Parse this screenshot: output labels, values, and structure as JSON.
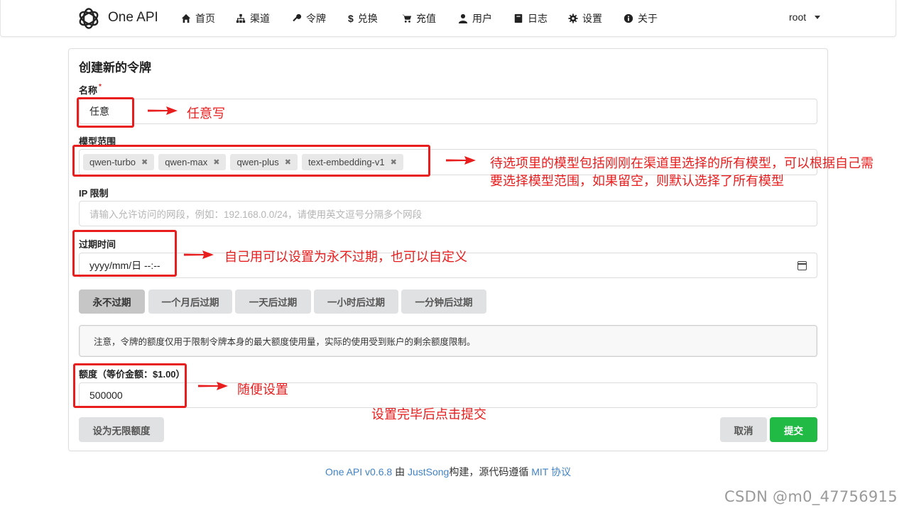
{
  "nav": {
    "brand": "One API",
    "items": [
      {
        "label": "首页",
        "icon": "home-icon"
      },
      {
        "label": "渠道",
        "icon": "sitemap-icon"
      },
      {
        "label": "令牌",
        "icon": "key-icon"
      },
      {
        "label": "兑换",
        "icon": "dollar-icon"
      },
      {
        "label": "充值",
        "icon": "cart-icon"
      },
      {
        "label": "用户",
        "icon": "user-icon"
      },
      {
        "label": "日志",
        "icon": "book-icon"
      },
      {
        "label": "设置",
        "icon": "gear-icon"
      },
      {
        "label": "关于",
        "icon": "info-icon"
      }
    ],
    "user": "root"
  },
  "form": {
    "title": "创建新的令牌",
    "name_label": "名称",
    "name_required_mark": "*",
    "name_value": "任意",
    "models_label": "模型范围",
    "models": [
      "qwen-turbo",
      "qwen-max",
      "qwen-plus",
      "text-embedding-v1"
    ],
    "ip_label": "IP 限制",
    "ip_placeholder": "请输入允许访问的网段，例如：192.168.0.0/24，请使用英文逗号分隔多个网段",
    "expire_label": "过期时间",
    "expire_value": "yyyy/mm/日 --:--",
    "expire_buttons": [
      "永不过期",
      "一个月后过期",
      "一天后过期",
      "一小时后过期",
      "一分钟后过期"
    ],
    "notice": "注意，令牌的额度仅用于限制令牌本身的最大额度使用量，实际的使用受到账户的剩余额度限制。",
    "quota_label": "额度（等价金额：$1.00）",
    "quota_value": "500000",
    "unlimited_button": "设为无限额度",
    "cancel_button": "取消",
    "submit_button": "提交"
  },
  "footer": {
    "version": "One API v0.6.8",
    "by": "由",
    "author": "JustSong",
    "built": "构建，源代码遵循",
    "license": "MIT 协议"
  },
  "annotations": {
    "name_note": "任意写",
    "models_note_line1": "待选项里的模型包括刚刚在渠道里选择的所有模型，可以根据自己需",
    "models_note_line2": "要选择模型范围，如果留空，则默认选择了所有模型",
    "expire_note": "自己用可以设置为永不过期，也可以自定义",
    "quota_note": "随便设置",
    "submit_note": "设置完毕后点击提交",
    "color": "#e81d1d"
  },
  "watermark": "CSDN @m0_47756915"
}
